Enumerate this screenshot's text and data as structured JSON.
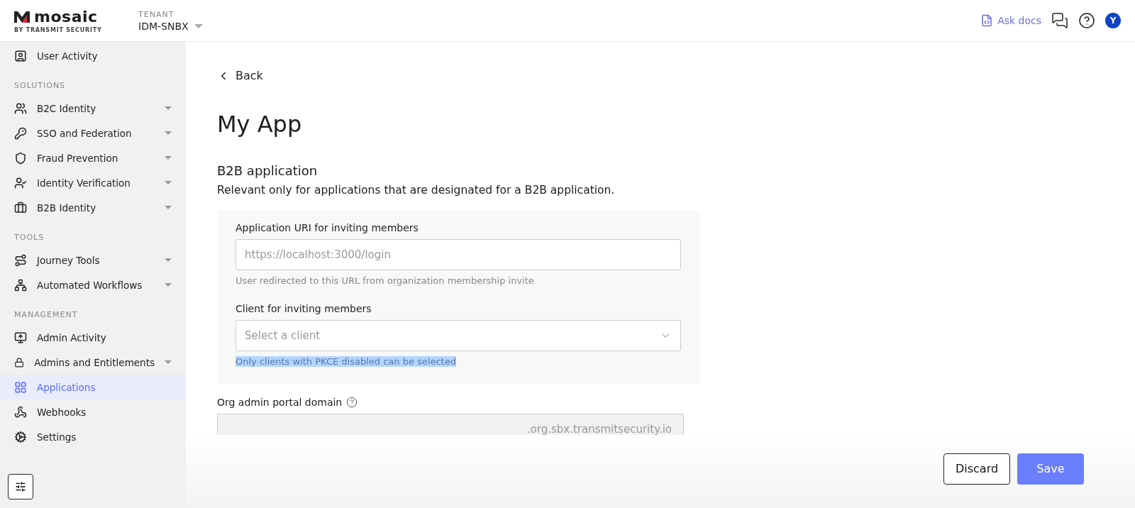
{
  "header": {
    "brand": "mosaic",
    "brand_sub": "BY TRANSMIT SECURITY",
    "tenant_label": "TENANT",
    "tenant": "IDM-SNBX",
    "ask_docs": "Ask docs",
    "avatar": "Y"
  },
  "sidebar": {
    "sections": [
      {
        "items": [
          {
            "label": "User Activity",
            "expandable": false,
            "selected": false
          }
        ]
      },
      {
        "title": "SOLUTIONS",
        "items": [
          {
            "label": "B2C Identity",
            "expandable": true,
            "selected": false
          },
          {
            "label": "SSO and Federation",
            "expandable": true,
            "selected": false
          },
          {
            "label": "Fraud Prevention",
            "expandable": true,
            "selected": false
          },
          {
            "label": "Identity Verification",
            "expandable": true,
            "selected": false
          },
          {
            "label": "B2B Identity",
            "expandable": true,
            "selected": false
          }
        ]
      },
      {
        "title": "TOOLS",
        "items": [
          {
            "label": "Journey Tools",
            "expandable": true,
            "selected": false
          },
          {
            "label": "Automated Workflows",
            "expandable": true,
            "selected": false
          }
        ]
      },
      {
        "title": "MANAGEMENT",
        "items": [
          {
            "label": "Admin Activity",
            "expandable": false,
            "selected": false
          },
          {
            "label": "Admins and Entitlements",
            "expandable": true,
            "selected": false
          },
          {
            "label": "Applications",
            "expandable": false,
            "selected": true
          },
          {
            "label": "Webhooks",
            "expandable": false,
            "selected": false
          },
          {
            "label": "Settings",
            "expandable": false,
            "selected": false
          }
        ]
      }
    ]
  },
  "main": {
    "back": "Back",
    "title": "My App",
    "section_title": "B2B application",
    "section_description": "Relevant only for applications that are designated for a B2B application.",
    "panel_fields": [
      {
        "kind": "input",
        "label": "Application URI for inviting members",
        "placeholder": "https://localhost:3000/login",
        "hint": "User redirected to this URL from organization membership invite",
        "hint_highlighted": false
      },
      {
        "kind": "select",
        "label": "Client for inviting members",
        "placeholder": "Select a client",
        "hint": "Only clients with PKCE disabled can be selected",
        "hint_highlighted": true
      }
    ],
    "domain_field": {
      "label": "Org admin portal domain",
      "value": ".org.sbx.transmitsecurity.io",
      "disabled": true
    }
  },
  "footer": {
    "buttons": [
      {
        "label": "Discard",
        "kind": "secondary"
      },
      {
        "label": "Save",
        "kind": "primary"
      }
    ]
  }
}
